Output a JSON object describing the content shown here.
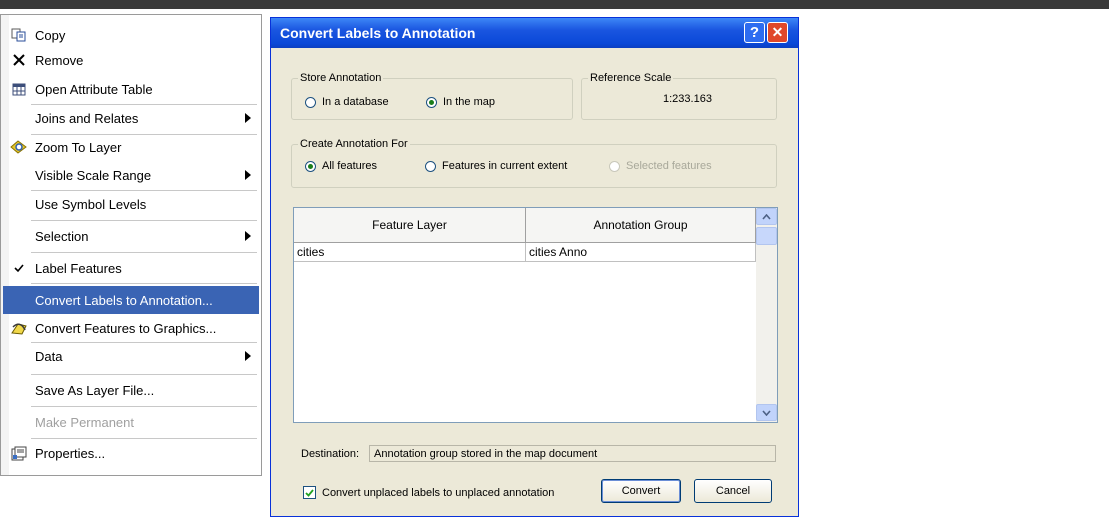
{
  "menu": {
    "items": [
      {
        "label": "Copy",
        "icon": "copy-icon",
        "submenu": false,
        "state": "normal"
      },
      {
        "label": "Remove",
        "icon": "remove-x-icon",
        "submenu": false,
        "state": "normal"
      },
      {
        "label": "Open Attribute Table",
        "icon": "table-icon",
        "submenu": false,
        "state": "normal"
      },
      {
        "label": "Joins and Relates",
        "icon": "",
        "submenu": true,
        "state": "normal"
      },
      {
        "label": "Zoom To Layer",
        "icon": "zoom-to-layer-icon",
        "submenu": false,
        "state": "normal"
      },
      {
        "label": "Visible Scale Range",
        "icon": "",
        "submenu": true,
        "state": "normal"
      },
      {
        "label": "Use Symbol Levels",
        "icon": "",
        "submenu": false,
        "state": "normal"
      },
      {
        "label": "Selection",
        "icon": "",
        "submenu": true,
        "state": "normal"
      },
      {
        "label": "Label Features",
        "icon": "checkmark-icon",
        "submenu": false,
        "state": "checked"
      },
      {
        "label": "Convert Labels to Annotation...",
        "icon": "",
        "submenu": false,
        "state": "highlighted"
      },
      {
        "label": "Convert Features to Graphics...",
        "icon": "convert-graphics-icon",
        "submenu": false,
        "state": "normal"
      },
      {
        "label": "Data",
        "icon": "",
        "submenu": true,
        "state": "normal"
      },
      {
        "label": "Save As Layer File...",
        "icon": "",
        "submenu": false,
        "state": "normal"
      },
      {
        "label": "Make Permanent",
        "icon": "",
        "submenu": false,
        "state": "disabled"
      },
      {
        "label": "Properties...",
        "icon": "properties-icon",
        "submenu": false,
        "state": "normal"
      }
    ]
  },
  "dialog": {
    "title": "Convert Labels to Annotation",
    "help_glyph": "?",
    "close_glyph": "✕",
    "store": {
      "legend": "Store Annotation",
      "options": [
        "In a database",
        "In the map"
      ],
      "selected": "In the map"
    },
    "reference_scale": {
      "legend": "Reference Scale",
      "value": "1:233.163"
    },
    "create_for": {
      "legend": "Create Annotation For",
      "options": [
        "All features",
        "Features in current extent",
        "Selected features"
      ],
      "selected": "All features",
      "disabled": [
        "Selected features"
      ]
    },
    "table": {
      "columns": [
        "Feature Layer",
        "Annotation Group"
      ],
      "rows": [
        [
          "cities",
          "cities Anno"
        ]
      ]
    },
    "destination": {
      "label": "Destination:",
      "value": "Annotation group stored in the map document"
    },
    "checkbox": {
      "label": "Convert unplaced labels to unplaced annotation",
      "checked": true
    },
    "buttons": {
      "convert": "Convert",
      "cancel": "Cancel"
    }
  },
  "colors": {
    "titlebar": "#0a48d8",
    "menu_highlight": "#3a64b4",
    "dialog_bg": "#ece9d8"
  }
}
